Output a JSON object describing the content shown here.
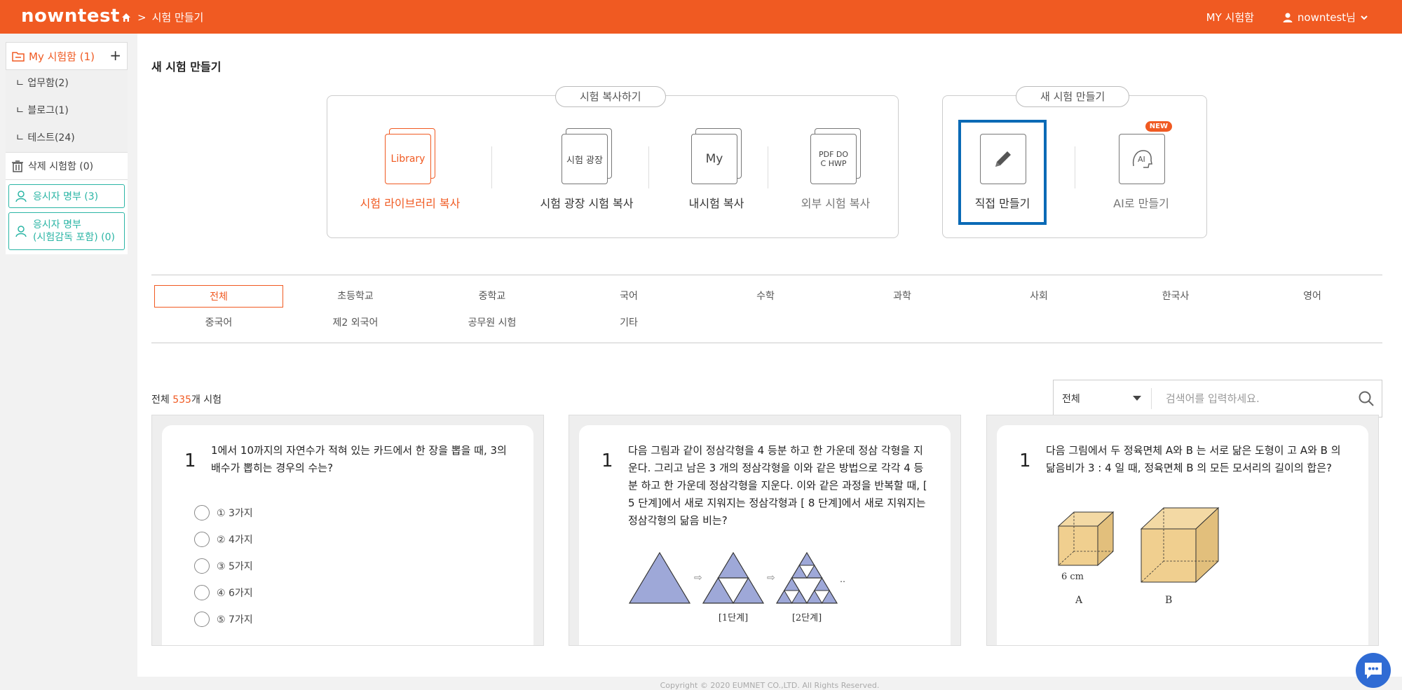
{
  "header": {
    "logo": "nowntest",
    "breadcrumb": "시험 만들기",
    "my_exams": "MY 시험함",
    "user": "nowntest님"
  },
  "sidebar": {
    "folder_title": "My 시험함 (1)",
    "subfolders": [
      "ㄴ 업무함(2)",
      "ㄴ 블로그(1)",
      "ㄴ 테스트(24)"
    ],
    "trash": "삭제 시험함 (0)",
    "roster": "응시자 명부 (3)",
    "roster_proctor_line1": "응시자 명부",
    "roster_proctor_line2": "(시험감독 포함) (0)"
  },
  "main": {
    "title": "새 시험 만들기",
    "copy_section": "시험 복사하기",
    "new_section": "새 시험 만들기",
    "copy_options": [
      {
        "label": "시험 라이브러리 복사",
        "icon_text": "Library"
      },
      {
        "label": "시험 광장 시험 복사",
        "icon_text": "시험 광장"
      },
      {
        "label": "내시험 복사",
        "icon_text": "My"
      },
      {
        "label": "외부 시험 복사",
        "icon_text": "PDF DOC HWP"
      }
    ],
    "new_options": [
      {
        "label": "직접 만들기"
      },
      {
        "label": "AI로 만들기",
        "badge": "NEW",
        "icon_text": "AI"
      }
    ],
    "categories": [
      "전체",
      "초등학교",
      "중학교",
      "국어",
      "수학",
      "과학",
      "사회",
      "한국사",
      "영어",
      "중국어",
      "제2 외국어",
      "공무원 시험",
      "기타"
    ],
    "count_prefix": "전체 ",
    "count_num": "535",
    "count_suffix": "개 시험",
    "search": {
      "select": "전체",
      "placeholder": "검색어를 입력하세요."
    }
  },
  "questions": [
    {
      "num": "1",
      "text": "1에서 10까지의 자연수가 적혀 있는 카드에서 한 장을 뽑을 때, 3의 배수가 뽑히는 경우의 수는?",
      "choices": [
        "① 3가지",
        "② 4가지",
        "③ 5가지",
        "④ 6가지",
        "⑤ 7가지"
      ]
    },
    {
      "num": "1",
      "text": "다음 그림과 같이 정삼각형을 4 등분 하고 한 가운데 정삼 각형을 지운다. 그리고 남은 3 개의 정삼각형을 이와 같은 방법으로 각각 4 등분 하고 한 가운데 정삼각형을 지운다. 이와 같은 과정을 반복할 때, [ 5 단계]에서 새로 지워지는 정삼각형과 [ 8 단계]에서 새로 지워지는 정삼각형의 닮음 비는?",
      "fig_labels": [
        "[1단계]",
        "[2단계]",
        "…"
      ]
    },
    {
      "num": "1",
      "text": "다음 그림에서 두 정육면체 A와 B 는 서로 닮은 도형이 고 A와 B 의 닮음비가 3 : 4 일 때, 정육면체 B 의 모든 모서리의 길이의 합은?",
      "fig_labels": [
        "6 cm",
        "A",
        "B"
      ]
    }
  ],
  "footer": "Copyright © 2020 EUMNET CO.,LTD. All Rights Reserved.",
  "colors": {
    "brand": "#f05a22",
    "teal": "#2bb5a5",
    "highlight": "#0a6ab6"
  }
}
